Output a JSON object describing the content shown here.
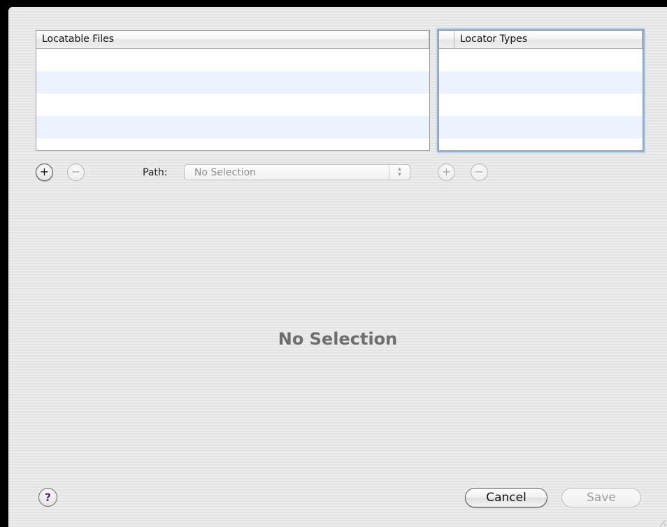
{
  "files_table": {
    "column": "Locatable Files",
    "rows": [
      "",
      "",
      "",
      ""
    ]
  },
  "types_table": {
    "column": "Locator Types",
    "rows": [
      "",
      "",
      "",
      ""
    ]
  },
  "file_buttons": {
    "add": "+",
    "remove": "−"
  },
  "type_buttons": {
    "add": "+",
    "remove": "−"
  },
  "path": {
    "label": "Path:",
    "value": "No Selection",
    "stepper": "▴▾"
  },
  "detail": {
    "empty_text": "No Selection"
  },
  "footer": {
    "help": "?",
    "cancel": "Cancel",
    "save": "Save"
  },
  "colors": {
    "row_alt": "#edf3fe",
    "focus_ring": "#8fb3da"
  }
}
